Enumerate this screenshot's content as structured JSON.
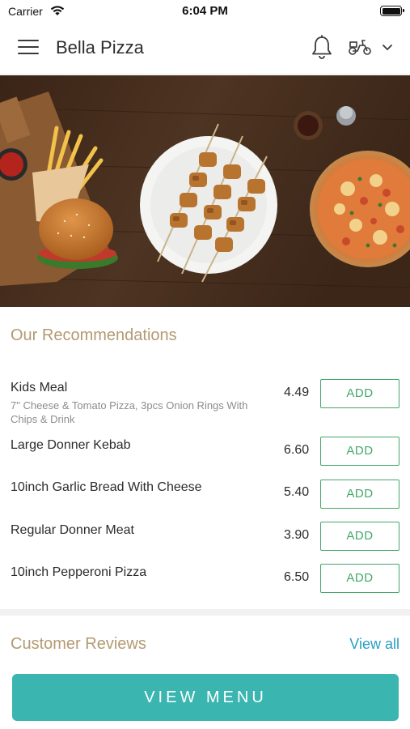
{
  "status_bar": {
    "carrier": "Carrier",
    "time": "6:04 PM"
  },
  "header": {
    "title": "Bella Pizza",
    "icons": [
      "menu-icon",
      "bell-icon",
      "delivery-scooter-icon",
      "chevron-down-icon"
    ]
  },
  "hero": {
    "image": "food-banner (burger, fries, chicken skewers, pizza on wooden table)"
  },
  "recommendations": {
    "title": "Our Recommendations",
    "items": [
      {
        "name": "Kids Meal",
        "description": "7\" Cheese & Tomato Pizza, 3pcs Onion Rings With Chips & Drink",
        "price": "4.49",
        "button": "ADD"
      },
      {
        "name": "Large Donner Kebab",
        "description": "",
        "price": "6.60",
        "button": "ADD"
      },
      {
        "name": "10inch Garlic Bread With Cheese",
        "description": "",
        "price": "5.40",
        "button": "ADD"
      },
      {
        "name": "Regular Donner Meat",
        "description": "",
        "price": "3.90",
        "button": "ADD"
      },
      {
        "name": "10inch Pepperoni Pizza",
        "description": "",
        "price": "6.50",
        "button": "ADD"
      }
    ]
  },
  "reviews": {
    "title": "Customer Reviews",
    "view_all": "View all"
  },
  "cta": {
    "label": "VIEW MENU"
  },
  "colors": {
    "section_title": "#b49a72",
    "add_button": "#43a868",
    "link": "#2a9fc3",
    "cta_background": "#3ab5b0"
  }
}
